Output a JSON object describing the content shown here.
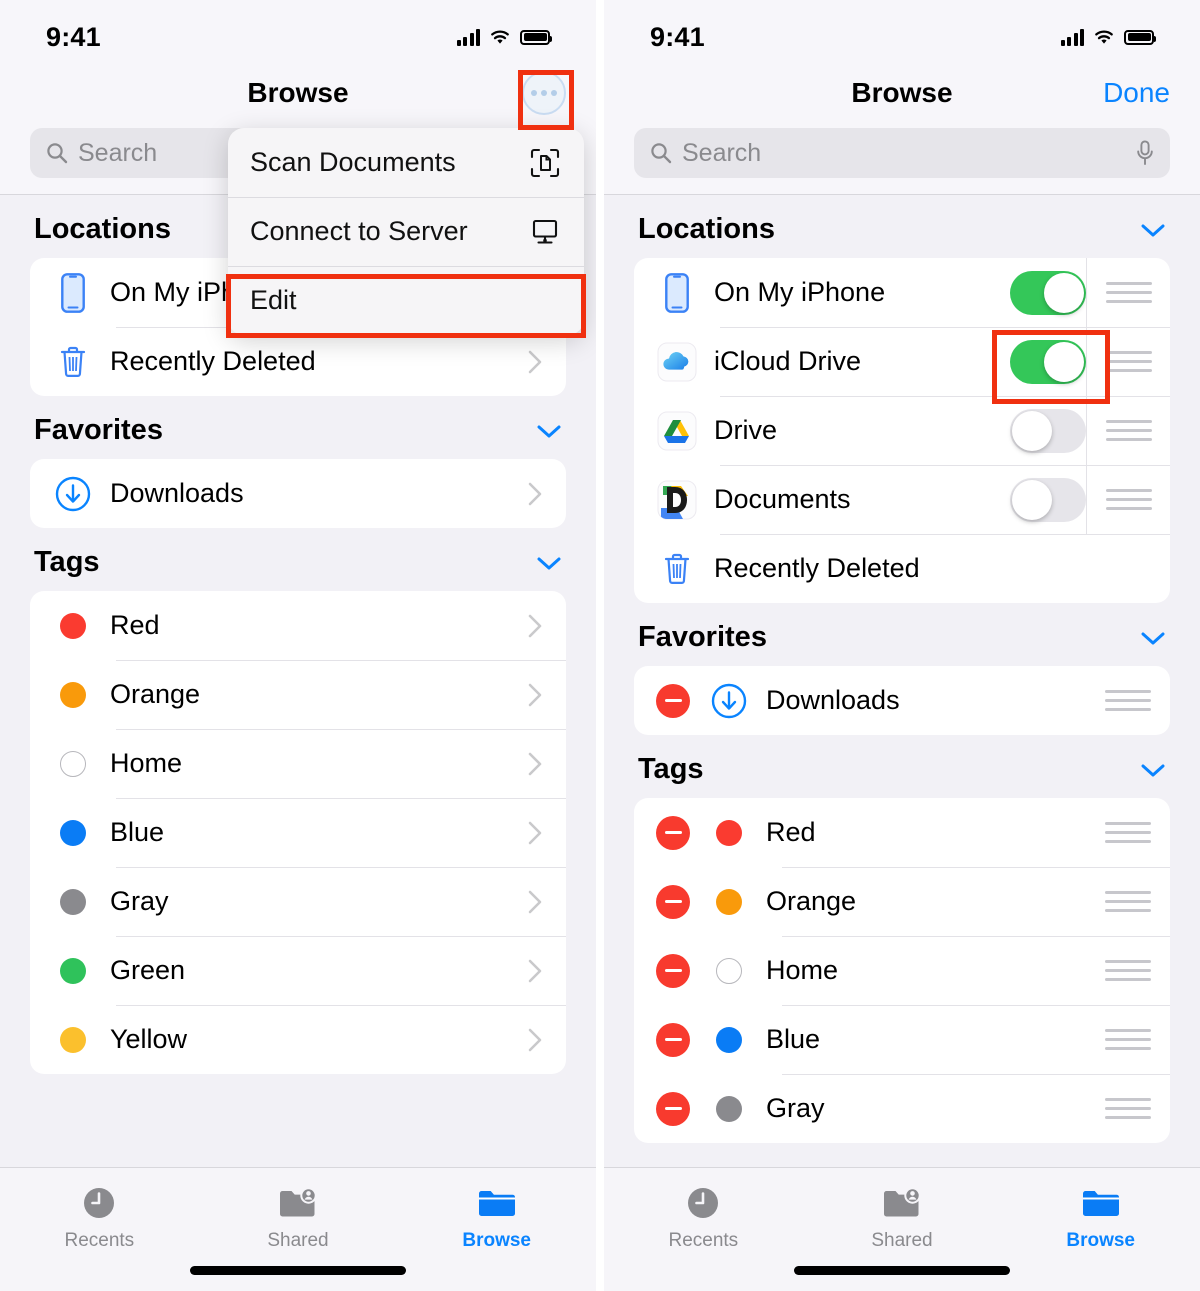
{
  "status_bar": {
    "time": "9:41",
    "icons": [
      "cellular-bars-icon",
      "wifi-icon",
      "battery-icon"
    ]
  },
  "colors": {
    "accent_blue": "#0a84ff",
    "toggle_on_green": "#34c759",
    "highlight_red": "#f03010",
    "delete_red": "#f83a2e",
    "tag_red": "#fa3b30",
    "tag_orange": "#f99a0b",
    "tag_blue": "#0a7cf5",
    "tag_gray": "#8a8a8e",
    "tag_green": "#2fc25b",
    "tag_yellow": "#fbc02d",
    "page_bg": "#f2f1f6",
    "card_bg": "#ffffff"
  },
  "left_panel": {
    "nav": {
      "title": "Browse",
      "more_button": "more-options-button"
    },
    "search": {
      "placeholder": "Search",
      "has_mic": false
    },
    "menu": {
      "items": [
        {
          "label": "Scan Documents",
          "icon": "scan-documents-icon",
          "highlighted": false
        },
        {
          "label": "Connect to Server",
          "icon": "display-monitor-icon",
          "highlighted": false
        },
        {
          "label": "Edit",
          "icon": "",
          "highlighted": true
        }
      ]
    },
    "sections": [
      {
        "title": "Locations",
        "collapsible": false,
        "rows": [
          {
            "label": "On My iPhone",
            "icon": "iphone-icon",
            "chevron": true
          },
          {
            "label": "Recently Deleted",
            "icon": "trash-icon",
            "chevron": true
          }
        ]
      },
      {
        "title": "Favorites",
        "collapsible": true,
        "rows": [
          {
            "label": "Downloads",
            "icon": "download-circle-icon",
            "chevron": true
          }
        ]
      },
      {
        "title": "Tags",
        "collapsible": true,
        "rows": [
          {
            "label": "Red",
            "dot": "#fa3b30",
            "chevron": true
          },
          {
            "label": "Orange",
            "dot": "#f99a0b",
            "chevron": true
          },
          {
            "label": "Home",
            "dot": "hollow",
            "chevron": true
          },
          {
            "label": "Blue",
            "dot": "#0a7cf5",
            "chevron": true
          },
          {
            "label": "Gray",
            "dot": "#8a8a8e",
            "chevron": true
          },
          {
            "label": "Green",
            "dot": "#2fc25b",
            "chevron": true
          },
          {
            "label": "Yellow",
            "dot": "#fbc02d",
            "chevron": true
          }
        ]
      }
    ],
    "tabs": [
      {
        "label": "Recents",
        "icon": "clock-icon",
        "active": false
      },
      {
        "label": "Shared",
        "icon": "shared-folder-icon",
        "active": false
      },
      {
        "label": "Browse",
        "icon": "folder-icon",
        "active": true
      }
    ],
    "highlights": [
      {
        "target": "more-options-button"
      },
      {
        "target": "menu-item-edit"
      }
    ]
  },
  "right_panel": {
    "nav": {
      "title": "Browse",
      "done_label": "Done"
    },
    "search": {
      "placeholder": "Search",
      "has_mic": true
    },
    "sections": [
      {
        "title": "Locations",
        "collapsible": true,
        "rows": [
          {
            "label": "On My iPhone",
            "icon": "iphone-icon",
            "toggle": "on",
            "grip": true
          },
          {
            "label": "iCloud Drive",
            "icon": "icloud-icon",
            "toggle": "on",
            "grip": true,
            "highlighted": true
          },
          {
            "label": "Drive",
            "icon": "google-drive-icon",
            "toggle": "off",
            "grip": true
          },
          {
            "label": "Documents",
            "icon": "documents-app-icon",
            "toggle": "off",
            "grip": true
          },
          {
            "label": "Recently Deleted",
            "icon": "trash-icon",
            "toggle": "none",
            "grip": false
          }
        ]
      },
      {
        "title": "Favorites",
        "collapsible": true,
        "rows": [
          {
            "label": "Downloads",
            "icon": "download-circle-icon",
            "minus": true,
            "grip": true
          }
        ]
      },
      {
        "title": "Tags",
        "collapsible": true,
        "rows": [
          {
            "label": "Red",
            "dot": "#fa3b30",
            "minus": true,
            "grip": true
          },
          {
            "label": "Orange",
            "dot": "#f99a0b",
            "minus": true,
            "grip": true
          },
          {
            "label": "Home",
            "dot": "hollow",
            "minus": true,
            "grip": true
          },
          {
            "label": "Blue",
            "dot": "#0a7cf5",
            "minus": true,
            "grip": true
          },
          {
            "label": "Gray",
            "dot": "#8a8a8e",
            "minus": true,
            "grip": true
          }
        ]
      }
    ],
    "tabs": [
      {
        "label": "Recents",
        "icon": "clock-icon",
        "active": false
      },
      {
        "label": "Shared",
        "icon": "shared-folder-icon",
        "active": false
      },
      {
        "label": "Browse",
        "icon": "folder-icon",
        "active": true
      }
    ],
    "highlights": [
      {
        "target": "icloud-drive-toggle"
      }
    ]
  }
}
